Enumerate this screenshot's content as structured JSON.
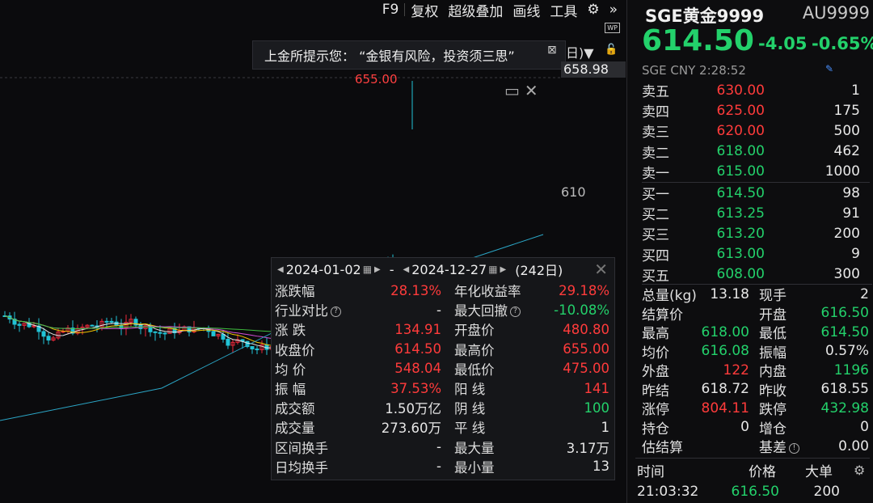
{
  "toolbar": {
    "items": [
      "F9",
      "复权",
      "超级叠加",
      "画线",
      "工具"
    ],
    "wp_badge": "WP"
  },
  "notice": {
    "text": "上金所提示您：  “金银有风险，投资须三思”",
    "tail": "日)▼"
  },
  "chart": {
    "price_tag": "658.98",
    "axis_tick": "610",
    "high_label": "655.00",
    "candles_visible": true
  },
  "stats": {
    "start_date": "2024-01-02",
    "end_date": "2024-12-27",
    "range_sep": "-",
    "days": "(242日)",
    "left": [
      {
        "label": "涨跌幅",
        "value": "28.13%",
        "tone": "up"
      },
      {
        "label": "行业对比",
        "value": "-",
        "tone": "white",
        "help": true
      },
      {
        "label": "涨  跌",
        "value": "134.91",
        "tone": "up"
      },
      {
        "label": "收盘价",
        "value": "614.50",
        "tone": "up"
      },
      {
        "label": "均  价",
        "value": "548.04",
        "tone": "up"
      },
      {
        "label": "振  幅",
        "value": "37.53%",
        "tone": "up"
      },
      {
        "label": "成交额",
        "value": "1.50万亿",
        "tone": "white"
      },
      {
        "label": "成交量",
        "value": "273.60万",
        "tone": "white"
      },
      {
        "label": "区间换手",
        "value": "-",
        "tone": "white"
      },
      {
        "label": "日均换手",
        "value": "-",
        "tone": "white"
      }
    ],
    "right": [
      {
        "label": "年化收益率",
        "value": "29.18%",
        "tone": "up"
      },
      {
        "label": "最大回撤",
        "value": "-10.08%",
        "tone": "down",
        "help": true
      },
      {
        "label": "开盘价",
        "value": "480.80",
        "tone": "up"
      },
      {
        "label": "最高价",
        "value": "655.00",
        "tone": "up"
      },
      {
        "label": "最低价",
        "value": "475.00",
        "tone": "up"
      },
      {
        "label": "阳  线",
        "value": "141",
        "tone": "up"
      },
      {
        "label": "阴  线",
        "value": "100",
        "tone": "down"
      },
      {
        "label": "平  线",
        "value": "1",
        "tone": "white"
      },
      {
        "label": "最大量",
        "value": "3.17万",
        "tone": "white"
      },
      {
        "label": "最小量",
        "value": "13",
        "tone": "white"
      }
    ]
  },
  "quote": {
    "name": "SGE黄金9999",
    "code": "AU9999",
    "price": "614.50",
    "change": "-4.05",
    "change_pct": "-0.65%",
    "exchange": "SGE",
    "currency": "CNY",
    "time": "2:28:52",
    "asks": [
      {
        "name": "卖五",
        "price": "630.00",
        "tone": "up",
        "vol": "1"
      },
      {
        "name": "卖四",
        "price": "625.00",
        "tone": "up",
        "vol": "175"
      },
      {
        "name": "卖三",
        "price": "620.00",
        "tone": "up",
        "vol": "500"
      },
      {
        "name": "卖二",
        "price": "618.00",
        "tone": "down",
        "vol": "462"
      },
      {
        "name": "卖一",
        "price": "615.00",
        "tone": "down",
        "vol": "1000"
      }
    ],
    "bids": [
      {
        "name": "买一",
        "price": "614.50",
        "tone": "down",
        "vol": "98"
      },
      {
        "name": "买二",
        "price": "613.25",
        "tone": "down",
        "vol": "91"
      },
      {
        "name": "买三",
        "price": "613.20",
        "tone": "down",
        "vol": "200"
      },
      {
        "name": "买四",
        "price": "613.00",
        "tone": "down",
        "vol": "9"
      },
      {
        "name": "买五",
        "price": "608.00",
        "tone": "down",
        "vol": "300"
      }
    ],
    "summary": [
      {
        "a": "总量(kg)",
        "b": "13.18",
        "bt": "white",
        "c": "现手",
        "d": "2",
        "dt": "white"
      },
      {
        "a": "结算价",
        "b": "",
        "bt": "white",
        "c": "开盘",
        "d": "616.50",
        "dt": "down"
      },
      {
        "a": "最高",
        "b": "618.00",
        "bt": "down",
        "c": "最低",
        "d": "614.50",
        "dt": "down"
      },
      {
        "a": "均价",
        "b": "616.08",
        "bt": "down",
        "c": "振幅",
        "d": "0.57%",
        "dt": "white"
      },
      {
        "a": "外盘",
        "b": "122",
        "bt": "up",
        "c": "内盘",
        "d": "1196",
        "dt": "down"
      },
      {
        "a": "昨结",
        "b": "618.72",
        "bt": "white",
        "c": "昨收",
        "d": "618.55",
        "dt": "white"
      },
      {
        "a": "涨停",
        "b": "804.11",
        "bt": "up",
        "c": "跌停",
        "d": "432.98",
        "dt": "down"
      },
      {
        "a": "持仓",
        "b": "0",
        "bt": "white",
        "c": "增仓",
        "d": "0",
        "dt": "white"
      },
      {
        "a": "估结算",
        "b": "",
        "bt": "white",
        "c": "基差",
        "d": "0.00",
        "dt": "white",
        "help": true
      }
    ],
    "ticks_header": {
      "time": "时间",
      "price": "价格",
      "volume": "大单"
    },
    "ticks": [
      {
        "time": "21:03:32",
        "price": "616.50",
        "vol": "200"
      }
    ]
  },
  "colors": {
    "up": "#ff3b3b",
    "down": "#23d16b",
    "bg": "#0d0d0f"
  }
}
